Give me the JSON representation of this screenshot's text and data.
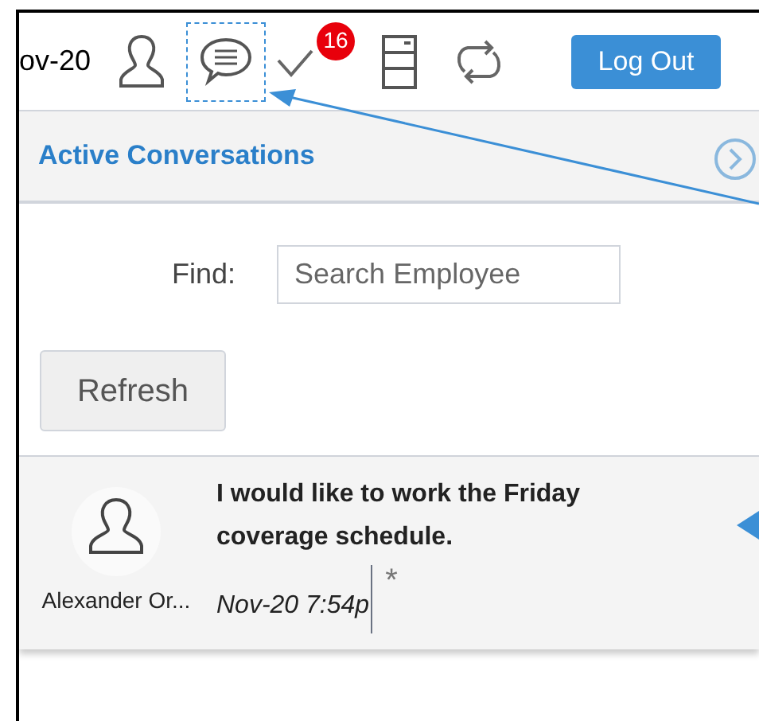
{
  "header": {
    "date": "ov-20",
    "icons": [
      {
        "kind": "person",
        "highlighted": false
      },
      {
        "kind": "chat",
        "highlighted": true
      },
      {
        "kind": "check",
        "highlighted": false,
        "badge": "16"
      },
      {
        "kind": "cabinet",
        "highlighted": false
      },
      {
        "kind": "sync",
        "highlighted": false
      }
    ],
    "logout": "Log Out"
  },
  "section": {
    "title": "Active Conversations"
  },
  "find": {
    "label": "Find:",
    "placeholder": "Search Employee"
  },
  "refresh": "Refresh",
  "conversations": [
    {
      "name": "Alexander Or...",
      "message": "I would like to work the Friday coverage schedule.",
      "time": "Nov-20 7:54p",
      "mark": "*"
    }
  ]
}
